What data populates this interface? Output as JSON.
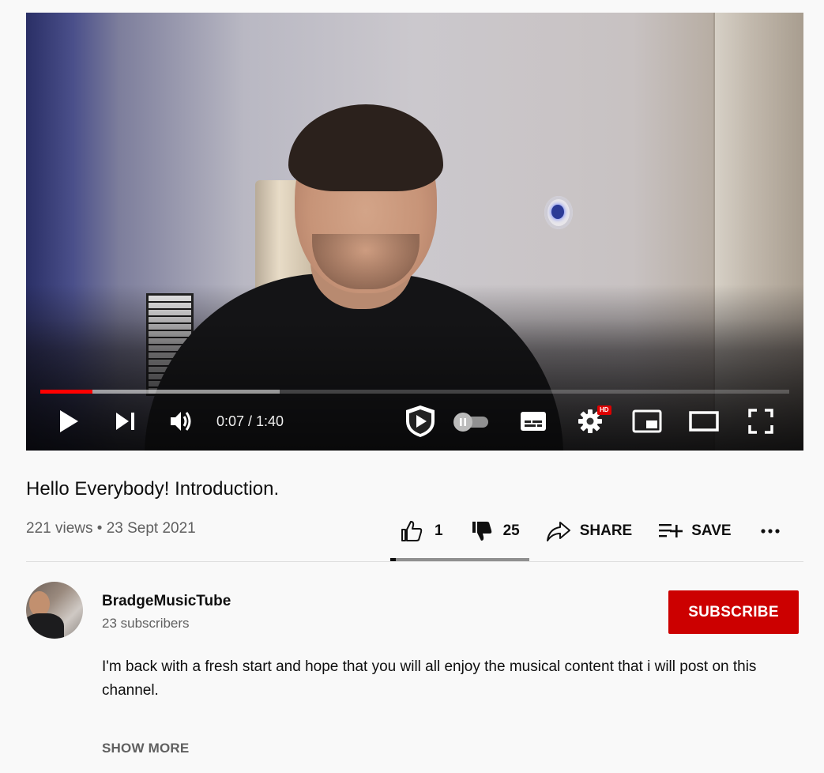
{
  "player": {
    "time_current": "0:07",
    "time_separator": " / ",
    "time_total": "1:40",
    "time_display": "0:07 / 1:40",
    "progress_played_fraction": 0.07,
    "progress_buffered_fraction": 0.32,
    "hd_badge": "HD",
    "icons": [
      "play-icon",
      "next-icon",
      "volume-icon",
      "channel-watermark-icon",
      "autoplay-toggle-icon",
      "subtitles-icon",
      "settings-icon",
      "miniplayer-icon",
      "theater-mode-icon",
      "fullscreen-icon"
    ]
  },
  "video": {
    "title": "Hello Everybody! Introduction.",
    "meta": "221 views • 23 Sept 2021"
  },
  "actions": {
    "like_count": "1",
    "dislike_count": "25",
    "share_label": "SHARE",
    "save_label": "SAVE",
    "more_label": "...",
    "like_ratio": 0.04
  },
  "channel": {
    "name": "BradgeMusicTube",
    "subscribers": "23 subscribers",
    "subscribe_label": "SUBSCRIBE"
  },
  "description": {
    "text": "I'm back with a fresh start and hope that you will all enjoy the musical content that i will post on this channel.",
    "show_more_label": "SHOW MORE"
  },
  "colors": {
    "progress_played": "#ff0000",
    "subscribe_bg": "#cc0000",
    "page_bg": "#f9f9f9",
    "secondary_text": "#606060"
  }
}
